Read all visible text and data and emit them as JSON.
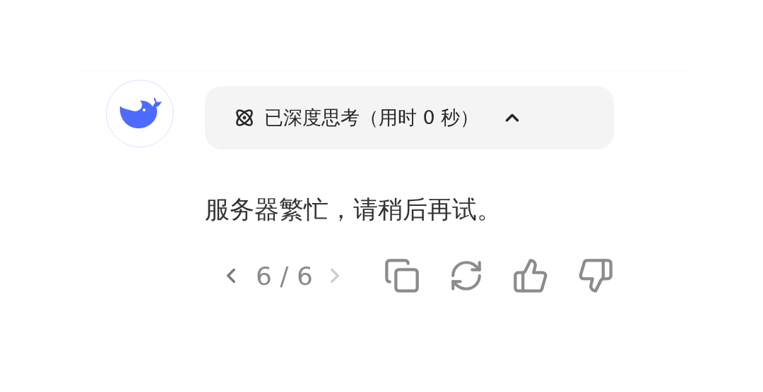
{
  "thinking": {
    "label": "已深度思考（用时 0 秒）",
    "expanded": true
  },
  "message": "服务器繁忙，请稍后再试。",
  "pager": {
    "text": "6 / 6",
    "prev_disabled": false,
    "next_disabled": true
  }
}
